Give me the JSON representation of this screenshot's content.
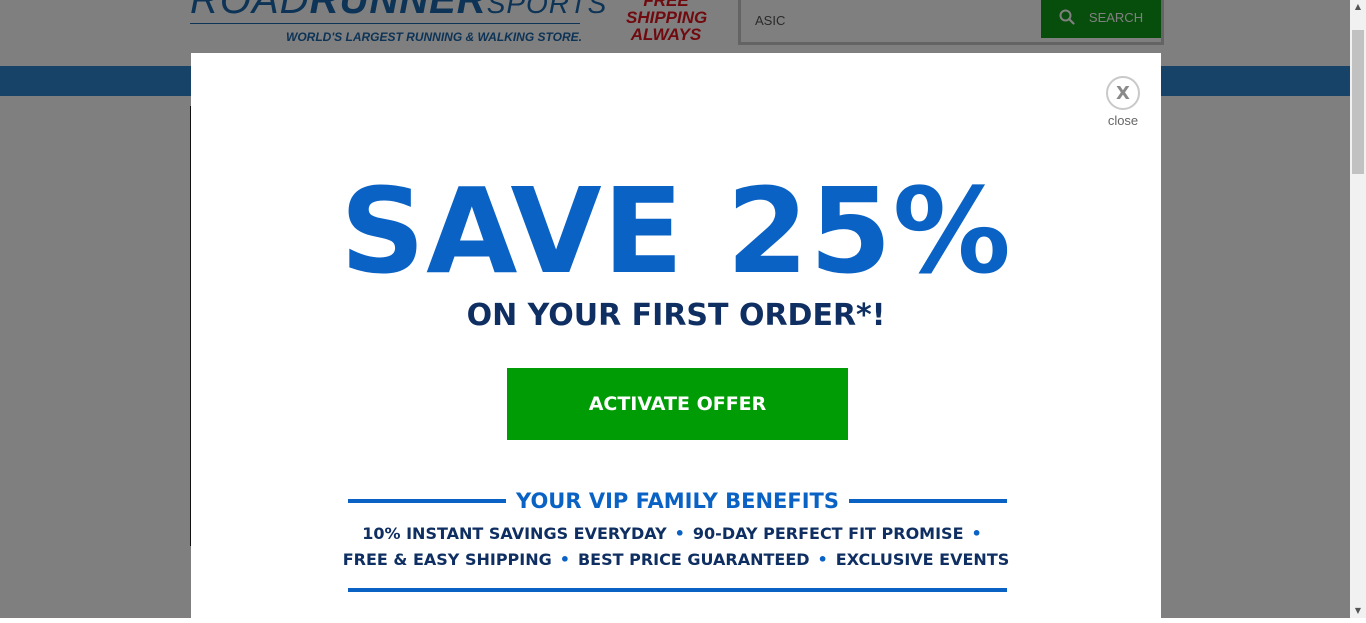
{
  "header": {
    "logo": {
      "part1": "ROAD",
      "part2": "RUNNER",
      "part3": "SPORTS",
      "tagline": "WORLD'S LARGEST RUNNING & WALKING STORE."
    },
    "shipping_line1": "FREE",
    "shipping_line2": "SHIPPING",
    "shipping_line3": "ALWAYS",
    "search": {
      "value": "ASIC",
      "button_label": "SEARCH"
    }
  },
  "modal": {
    "close_symbol": "X",
    "close_label": "close",
    "headline": "SAVE 25%",
    "subhead": "ON YOUR FIRST ORDER*!",
    "cta_label": "ACTIVATE OFFER",
    "vip_title": "YOUR VIP FAMILY BENEFITS",
    "benefits_row1": [
      "10% INSTANT SAVINGS EVERYDAY",
      "90-DAY PERFECT FIT PROMISE"
    ],
    "benefits_row2": [
      "FREE & EASY SHIPPING",
      "BEST PRICE GUARANTEED",
      "EXCLUSIVE EVENTS"
    ],
    "separator": "•"
  },
  "colors": {
    "brand_blue": "#0a62c5",
    "dark_navy": "#0f2f62",
    "cta_green": "#009c05",
    "search_green": "#0e9a16",
    "shipping_red": "#e0141e",
    "nav_blue": "#2d87cf"
  }
}
